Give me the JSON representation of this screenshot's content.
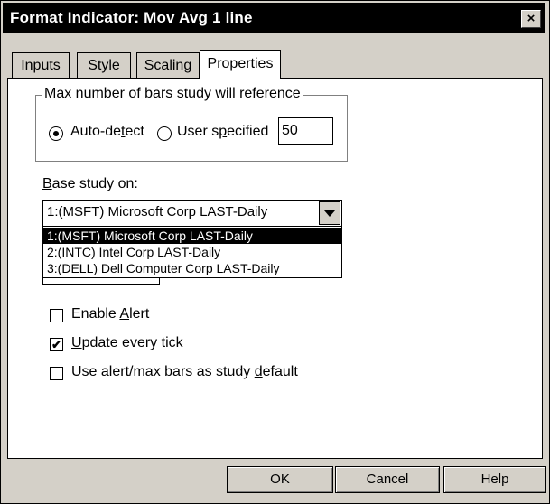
{
  "window": {
    "title": "Format Indicator: Mov Avg 1 line",
    "close_glyph": "×"
  },
  "tabs": [
    {
      "label": "Inputs"
    },
    {
      "label": "Style"
    },
    {
      "label": "Scaling"
    },
    {
      "label": "Properties"
    }
  ],
  "max_bars": {
    "legend": "Max number of bars study will reference",
    "auto_detect_label_pre": "Auto-de",
    "auto_detect_label_u": "t",
    "auto_detect_label_post": "ect",
    "user_specified_label_pre": "User s",
    "user_specified_label_u": "p",
    "user_specified_label_post": "ecified",
    "value": "50",
    "selected": "auto_detect"
  },
  "base_study": {
    "label_u": "B",
    "label_rest": "ase study on:",
    "selected_value": "1:(MSFT) Microsoft Corp LAST-Daily",
    "options": [
      "1:(MSFT) Microsoft Corp LAST-Daily",
      "2:(INTC) Intel Corp LAST-Daily",
      "3:(DELL) Dell Computer Corp LAST-Daily"
    ]
  },
  "checkboxes": {
    "enable_alert": {
      "pre": "Enable ",
      "u": "A",
      "post": "lert",
      "checked": false
    },
    "update_every_tick": {
      "pre": "",
      "u": "U",
      "post": "pdate every tick",
      "checked": true
    },
    "use_alert_default": {
      "pre": "Use alert/max bars as study ",
      "u": "d",
      "post": "efault",
      "checked": false
    },
    "check_glyph": "✔"
  },
  "buttons": {
    "ok": "OK",
    "cancel": "Cancel",
    "help": "Help"
  }
}
